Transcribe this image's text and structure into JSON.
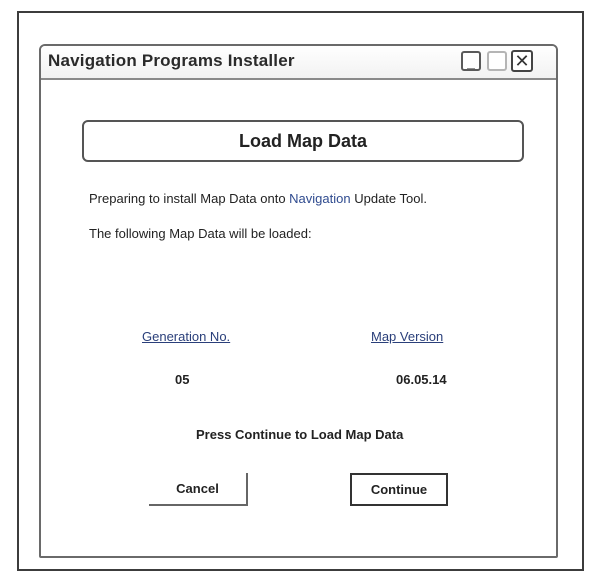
{
  "window": {
    "title": "Navigation Programs Installer",
    "minimize_glyph": "_",
    "maximize_glyph": "□",
    "close_glyph": "✕"
  },
  "heading": "Load Map Data",
  "message": {
    "part1": "Preparing to install Map Data onto ",
    "highlight": "Navigation",
    "part2": " Update Tool.",
    "line2": "The following Map Data will be loaded:"
  },
  "table": {
    "columns": [
      "Generation No.",
      "Map Version"
    ],
    "values": [
      "05",
      "06.05.14"
    ]
  },
  "prompt": "Press Continue to Load Map Data",
  "buttons": {
    "cancel": "Cancel",
    "continue": "Continue"
  },
  "colors": {
    "highlight_text": "#2f4b8f",
    "column_header": "#2a3f7a"
  }
}
